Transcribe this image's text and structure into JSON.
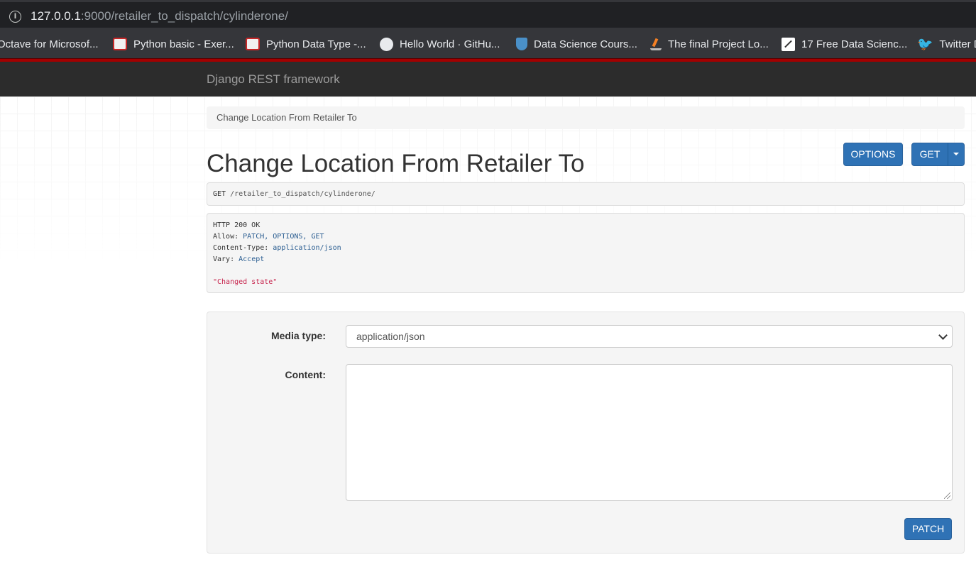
{
  "browser": {
    "url_host": "127.0.0.1",
    "url_rest": ":9000/retailer_to_dispatch/cylinderone/",
    "bookmarks": [
      {
        "label": "Octave for Microsof...",
        "icon": "octave-icon"
      },
      {
        "label": "Python basic - Exer...",
        "icon": "w3resource-icon"
      },
      {
        "label": "Python Data Type -...",
        "icon": "w3resource-icon"
      },
      {
        "label": "Hello World · GitHu...",
        "icon": "github-icon"
      },
      {
        "label": "Data Science Cours...",
        "icon": "shield-icon"
      },
      {
        "label": "The final Project Lo...",
        "icon": "stackoverflow-icon"
      },
      {
        "label": "17 Free Data Scienc...",
        "icon": "chart-icon"
      },
      {
        "label": "Twitter D",
        "icon": "twitter-icon"
      }
    ]
  },
  "navbar": {
    "brand": "Django REST framework"
  },
  "breadcrumb": {
    "current": "Change Location From Retailer To"
  },
  "page": {
    "title": "Change Location From Retailer To"
  },
  "buttons": {
    "options": "OPTIONS",
    "get": "GET",
    "patch": "PATCH"
  },
  "request": {
    "method": "GET",
    "path": " /retailer_to_dispatch/cylinderone/"
  },
  "response": {
    "status": "HTTP 200 OK",
    "headers": [
      {
        "key": "Allow:",
        "value": " PATCH, OPTIONS, GET"
      },
      {
        "key": "Content-Type:",
        "value": " application/json"
      },
      {
        "key": "Vary:",
        "value": " Accept"
      }
    ],
    "body": "\"Changed state\""
  },
  "form": {
    "media_type_label": "Media type:",
    "media_type_value": "application/json",
    "content_label": "Content:",
    "content_value": ""
  },
  "colors": {
    "accent": "#2f72b5",
    "navbar": "#2c2c2c",
    "navbar_rule": "#a30000"
  }
}
